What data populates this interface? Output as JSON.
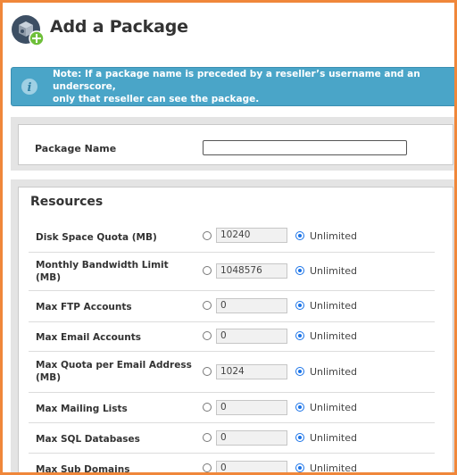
{
  "header": {
    "title": "Add a Package",
    "icon": "package-add-icon"
  },
  "note": {
    "line1": "Note: If a package name is preceded by a reseller’s username and an underscore,",
    "line2": "only that reseller can see the package.",
    "icon": "info-icon"
  },
  "package": {
    "label": "Package Name",
    "value": ""
  },
  "resources": {
    "title": "Resources",
    "unlimited_label": "Unlimited",
    "rows": [
      {
        "label": "Disk Space Quota (MB)",
        "value": "10240"
      },
      {
        "label": "Monthly Bandwidth Limit (MB)",
        "value": "1048576"
      },
      {
        "label": "Max FTP Accounts",
        "value": "0"
      },
      {
        "label": "Max Email Accounts",
        "value": "0"
      },
      {
        "label": "Max Quota per Email Address (MB)",
        "value": "1024"
      },
      {
        "label": "Max Mailing Lists",
        "value": "0"
      },
      {
        "label": "Max SQL Databases",
        "value": "0"
      },
      {
        "label": "Max Sub Domains",
        "value": "0"
      }
    ]
  },
  "colors": {
    "frame": "#f0873a",
    "note_bg": "#4aa5c8",
    "radio": "#1a73e8"
  }
}
